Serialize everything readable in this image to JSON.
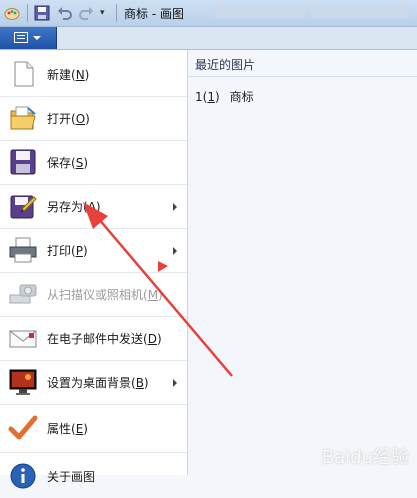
{
  "titlebar": {
    "title": "商标 - 画图",
    "app_icon": "paint-palette-icon",
    "quick_access": [
      "save-icon",
      "undo-icon",
      "redo-icon",
      "customize-chevron-icon"
    ]
  },
  "file_button": {
    "icon": "file-menu-icon"
  },
  "menu": {
    "items": [
      {
        "label_pre": "新建(",
        "key": "N",
        "label_post": ")",
        "icon": "new-file-icon",
        "submenu": false,
        "enabled": true
      },
      {
        "label_pre": "打开(",
        "key": "O",
        "label_post": ")",
        "icon": "open-folder-icon",
        "submenu": false,
        "enabled": true
      },
      {
        "label_pre": "保存(",
        "key": "S",
        "label_post": ")",
        "icon": "save-icon",
        "submenu": false,
        "enabled": true
      },
      {
        "label_pre": "另存为(",
        "key": "A",
        "label_post": ")",
        "icon": "save-as-icon",
        "submenu": true,
        "enabled": true
      },
      {
        "label_pre": "打印(",
        "key": "P",
        "label_post": ")",
        "icon": "printer-icon",
        "submenu": true,
        "enabled": true
      },
      {
        "label_pre": "从扫描仪或照相机(",
        "key": "M",
        "label_post": ")",
        "icon": "scanner-camera-icon",
        "submenu": false,
        "enabled": false
      },
      {
        "label_pre": "在电子邮件中发送(",
        "key": "D",
        "label_post": ")",
        "icon": "email-icon",
        "submenu": false,
        "enabled": true
      },
      {
        "label_pre": "设置为桌面背景(",
        "key": "B",
        "label_post": ")",
        "icon": "desktop-background-icon",
        "submenu": true,
        "enabled": true
      },
      {
        "label_pre": "属性(",
        "key": "E",
        "label_post": ")",
        "icon": "checkmark-icon",
        "submenu": false,
        "enabled": true
      },
      {
        "label_pre": "关于画图",
        "key": "",
        "label_post": "",
        "icon": "info-icon",
        "submenu": false,
        "enabled": true
      }
    ]
  },
  "recent": {
    "title": "最近的图片",
    "items": [
      {
        "num_pre": "1(",
        "num_key": "1",
        "num_post": ")",
        "name": "商标"
      }
    ]
  },
  "watermark": "Baidu经验",
  "annotation": {
    "arrow_color": "#e8413b"
  }
}
